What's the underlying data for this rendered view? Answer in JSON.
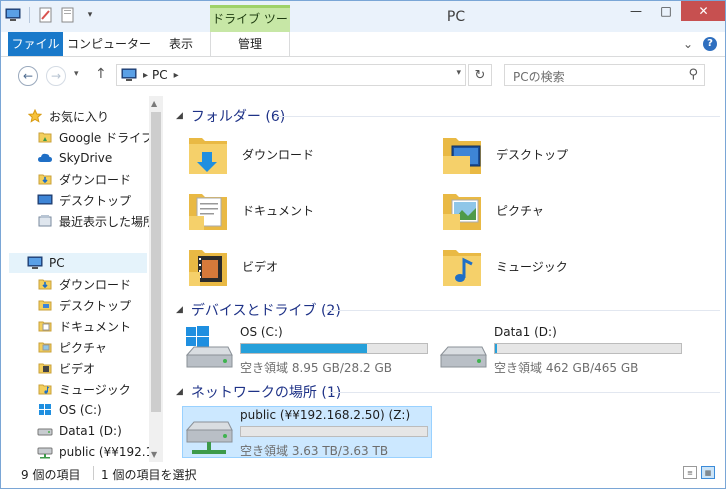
{
  "titlebar": {
    "title": "PC",
    "context_tab": "ドライブ ツール",
    "minimize": "—",
    "maximize": "□",
    "close": "✕"
  },
  "ribbon": {
    "tabs": [
      {
        "label": "ファイル"
      },
      {
        "label": "コンピューター"
      },
      {
        "label": "表示"
      },
      {
        "label": "管理"
      }
    ],
    "expand_icon": "⌄",
    "help": "?"
  },
  "addressbar": {
    "segments": [
      "PC"
    ],
    "search_placeholder": "PCの検索"
  },
  "sidebar": {
    "favorites": [
      {
        "label": "お気に入り",
        "icon": "star-icon"
      },
      {
        "label": "Google ドライブ",
        "icon": "folder-icon"
      },
      {
        "label": "SkyDrive",
        "icon": "cloud-icon"
      },
      {
        "label": "ダウンロード",
        "icon": "download-folder-icon"
      },
      {
        "label": "デスクトップ",
        "icon": "desktop-icon"
      },
      {
        "label": "最近表示した場所",
        "icon": "recent-places-icon"
      }
    ],
    "pc": {
      "label": "PC",
      "icon": "computer-icon"
    },
    "pc_items": [
      {
        "label": "ダウンロード",
        "icon": "download-folder-icon"
      },
      {
        "label": "デスクトップ",
        "icon": "desktop-folder-icon"
      },
      {
        "label": "ドキュメント",
        "icon": "documents-folder-icon"
      },
      {
        "label": "ピクチャ",
        "icon": "pictures-folder-icon"
      },
      {
        "label": "ビデオ",
        "icon": "videos-folder-icon"
      },
      {
        "label": "ミュージック",
        "icon": "music-folder-icon"
      },
      {
        "label": "OS (C:)",
        "icon": "windows-drive-icon"
      },
      {
        "label": "Data1 (D:)",
        "icon": "drive-icon"
      },
      {
        "label": "public (¥¥192.1",
        "icon": "network-drive-icon"
      }
    ]
  },
  "content": {
    "folders_header": "フォルダー (6)",
    "folders": [
      {
        "name": "ダウンロード",
        "overlay": "download-arrow"
      },
      {
        "name": "デスクトップ",
        "overlay": "desktop-screen"
      },
      {
        "name": "ドキュメント",
        "overlay": "document-pages"
      },
      {
        "name": "ピクチャ",
        "overlay": "landscape-photo"
      },
      {
        "name": "ビデオ",
        "overlay": "film-strip"
      },
      {
        "name": "ミュージック",
        "overlay": "music-note"
      }
    ],
    "drives_header": "デバイスとドライブ (2)",
    "drives": [
      {
        "name": "OS (C:)",
        "free": "空き領域 8.95 GB/28.2 GB",
        "used_fraction": 0.68,
        "color": "#26a0da"
      },
      {
        "name": "Data1 (D:)",
        "free": "空き領域 462 GB/465 GB",
        "used_fraction": 0.01,
        "color": "#26a0da"
      }
    ],
    "network_header": "ネットワークの場所 (1)",
    "network": [
      {
        "name": "public (¥¥192.168.2.50) (Z:)",
        "free": "空き領域 3.63 TB/3.63 TB",
        "used_fraction": 0.0
      }
    ]
  },
  "statusbar": {
    "count": "9 個の項目",
    "selected": "1 個の項目を選択"
  }
}
